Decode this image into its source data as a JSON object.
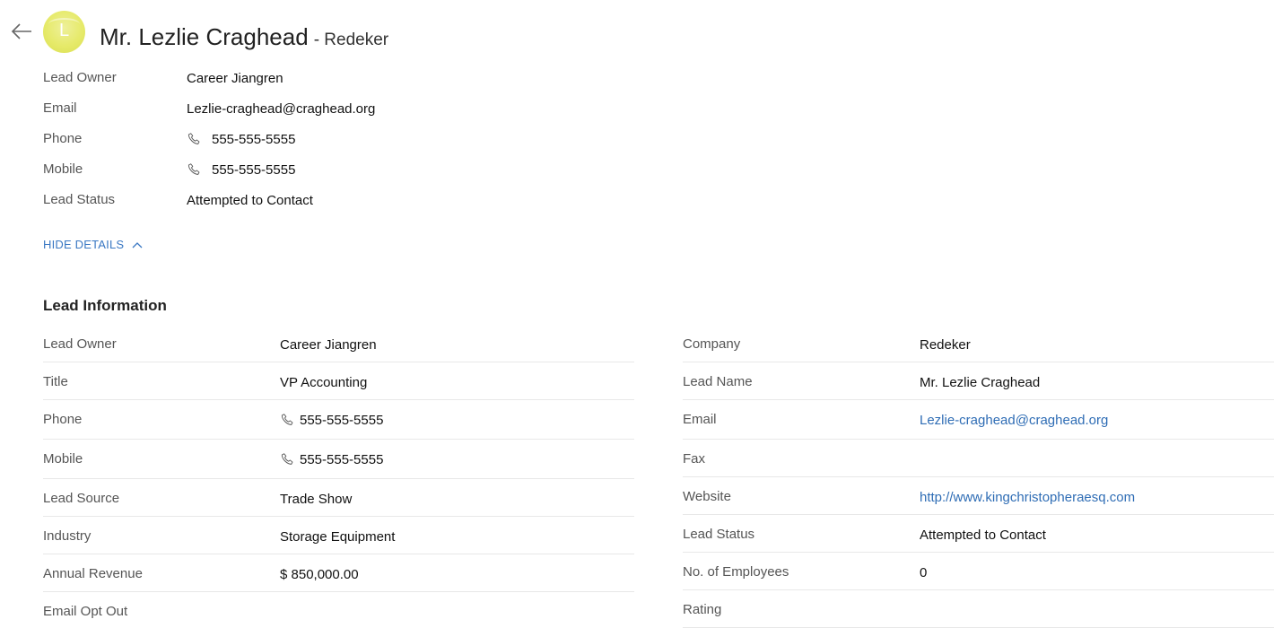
{
  "header": {
    "avatar_letter": "L",
    "name": "Mr. Lezlie Craghead",
    "company": "- Redeker"
  },
  "summary": [
    {
      "label": "Lead Owner",
      "value": "Career Jiangren",
      "icon": ""
    },
    {
      "label": "Email",
      "value": "Lezlie-craghead@craghead.org",
      "icon": ""
    },
    {
      "label": "Phone",
      "value": "555-555-5555",
      "icon": "phone-icon"
    },
    {
      "label": "Mobile",
      "value": "555-555-5555",
      "icon": "phone-icon"
    },
    {
      "label": "Lead Status",
      "value": "Attempted to Contact",
      "icon": ""
    }
  ],
  "toggle": {
    "label": "HIDE DETAILS"
  },
  "section": {
    "title": "Lead Information"
  },
  "left_fields": [
    {
      "label": "Lead Owner",
      "value": "Career Jiangren"
    },
    {
      "label": "Title",
      "value": "VP Accounting"
    },
    {
      "label": "Phone",
      "value": "555-555-5555"
    },
    {
      "label": "Mobile",
      "value": "555-555-5555"
    },
    {
      "label": "Lead Source",
      "value": "Trade Show"
    },
    {
      "label": "Industry",
      "value": "Storage Equipment"
    },
    {
      "label": "Annual Revenue",
      "value": "$ 850,000.00"
    },
    {
      "label": "Email Opt Out",
      "value": ""
    }
  ],
  "right_fields": [
    {
      "label": "Company",
      "value": "Redeker"
    },
    {
      "label": "Lead Name",
      "value": "Mr. Lezlie Craghead"
    },
    {
      "label": "Email",
      "value": "Lezlie-craghead@craghead.org"
    },
    {
      "label": "Fax",
      "value": ""
    },
    {
      "label": "Website",
      "value": "http://www.kingchristopheraesq.com"
    },
    {
      "label": "Lead Status",
      "value": "Attempted to Contact"
    },
    {
      "label": "No. of Employees",
      "value": "0"
    },
    {
      "label": "Rating",
      "value": ""
    }
  ],
  "colors": {
    "link": "#2f6db5",
    "toggle": "#3a78c3",
    "avatar": "#e6ea6a"
  }
}
